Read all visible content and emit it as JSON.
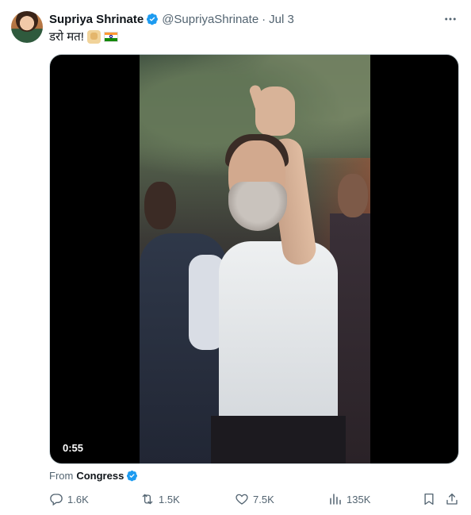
{
  "tweet": {
    "author_name": "Supriya Shrinate",
    "handle": "@SupriyaShrinate",
    "separator": "·",
    "date": "Jul 3",
    "text": "डरो मत!",
    "emojis": [
      "raised-fist",
      "india-flag"
    ],
    "media": {
      "type": "video",
      "duration": "0:55"
    },
    "source_prefix": "From",
    "source_name": "Congress",
    "actions": {
      "replies": "1.6K",
      "retweets": "1.5K",
      "likes": "7.5K",
      "views": "135K"
    }
  },
  "icons": {
    "verified": "verified-badge-icon",
    "more": "more-icon",
    "reply": "reply-icon",
    "retweet": "retweet-icon",
    "like": "heart-icon",
    "views": "views-icon",
    "bookmark": "bookmark-icon",
    "share": "share-icon"
  },
  "colors": {
    "verified_blue": "#1d9bf0",
    "text_primary": "#0f1419",
    "text_secondary": "#536471"
  }
}
